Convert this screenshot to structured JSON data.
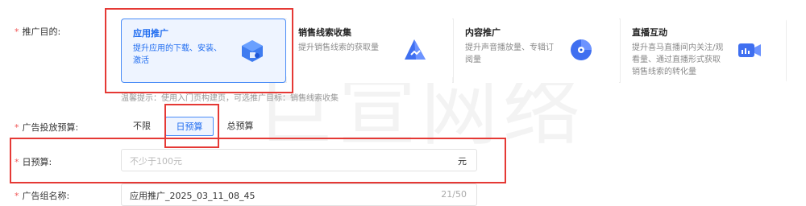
{
  "form": {
    "objective": {
      "label": "推广目的:",
      "cards": [
        {
          "title": "应用推广",
          "desc": "提升应用的下载、安装、激活",
          "icon": "app-cube-icon",
          "selected": true
        },
        {
          "title": "销售线索收集",
          "desc": "提升销售线索的获取量",
          "icon": "lead-collect-icon",
          "selected": false
        },
        {
          "title": "内容推广",
          "desc": "提升声音播放量、专辑订阅量",
          "icon": "content-disc-icon",
          "selected": false
        },
        {
          "title": "直播互动",
          "desc": "提升喜马直播间内关注/观看量、通过直播形式获取销售线索的转化量",
          "icon": "live-camera-icon",
          "selected": false
        }
      ],
      "hint": "温馨提示：使用入门页构建页，可选推广目标：销售线索收集"
    },
    "budget_type": {
      "label": "广告投放预算:",
      "options": [
        "不限",
        "日预算",
        "总预算"
      ],
      "selected": "日预算"
    },
    "daily_budget": {
      "label": "日预算:",
      "placeholder": "不少于100元",
      "unit": "元"
    },
    "group_name": {
      "label": "广告组名称:",
      "value": "应用推广_2025_03_11_08_45",
      "counter": "21/50"
    }
  },
  "watermark": "巨宣网络",
  "colors": {
    "accent": "#1f6cf0",
    "annotation": "#e53935",
    "required": "#f05a5a"
  }
}
